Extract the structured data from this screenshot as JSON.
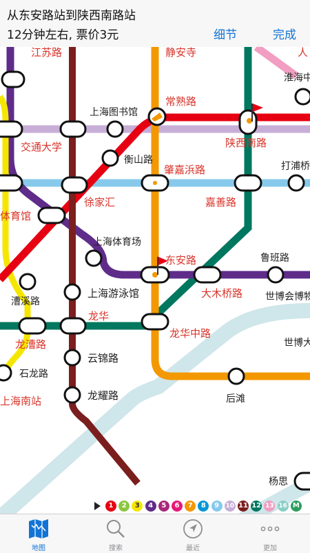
{
  "header": {
    "route_title": "从东安路站到陕西南路站",
    "route_summary": "12分钟左右, 票价3元",
    "detail_label": "细节",
    "done_label": "完成"
  },
  "stations": {
    "jiangsu_rd": "江苏路",
    "jingan_temple": "静安寺",
    "huaihai_rd": "淮海中",
    "top_right": "人",
    "shanghai_library": "上海图书馆",
    "changshu_rd": "常熟路",
    "jiaotong_univ": "交通大学",
    "shaanxi_south_rd": "陕西南路",
    "hengshan_rd": "衡山路",
    "zhaojiabang_rd": "肇嘉浜路",
    "dapuqiao": "打浦桥",
    "xujiahui": "徐家汇",
    "jiashan_rd": "嘉善路",
    "stadium": "体育馆",
    "shanghai_stadium": "上海体育场",
    "dongan_rd": "东安路",
    "luban_rd": "鲁班路",
    "caoxi_rd": "漕溪路",
    "shanghai_natatorium": "上海游泳馆",
    "damuqiao_rd": "大木桥路",
    "expo_museum": "世博会博物",
    "longhua": "龙华",
    "longhua_middle_rd": "龙华中路",
    "longcao_rd": "龙漕路",
    "yunjin_rd": "云锦路",
    "expo_avenue": "世博大",
    "shilong_rd": "石龙路",
    "houtan": "后滩",
    "longyao_rd": "龙耀路",
    "shanghai_south": "上海南站",
    "yangsi": "杨思"
  },
  "legend": {
    "lines": [
      {
        "label": "1",
        "color": "#e60012"
      },
      {
        "label": "2",
        "color": "#8cc63f"
      },
      {
        "label": "3",
        "color": "#f5e600"
      },
      {
        "label": "4",
        "color": "#5f2c8a"
      },
      {
        "label": "5",
        "color": "#a8287a"
      },
      {
        "label": "6",
        "color": "#e6197a"
      },
      {
        "label": "7",
        "color": "#f39800"
      },
      {
        "label": "8",
        "color": "#0097d6"
      },
      {
        "label": "9",
        "color": "#87c9eb"
      },
      {
        "label": "10",
        "color": "#c7aed7"
      },
      {
        "label": "11",
        "color": "#7b1e1e"
      },
      {
        "label": "12",
        "color": "#00775f"
      },
      {
        "label": "13",
        "color": "#f19ec2"
      },
      {
        "label": "16",
        "color": "#89cfc7"
      },
      {
        "label": "M",
        "color": "#2a9d5c"
      }
    ]
  },
  "tabs": [
    {
      "label": "地图",
      "icon": "map-icon"
    },
    {
      "label": "搜索",
      "icon": "search-icon"
    },
    {
      "label": "最近",
      "icon": "location-arrow-icon"
    },
    {
      "label": "更加",
      "icon": "more-icon"
    }
  ],
  "colors": {
    "accent": "#1273d6",
    "station_label_red": "#d9342b",
    "station_label_dark": "#222222",
    "line1": "#e60012",
    "line3": "#f5e600",
    "line4": "#5f2c8a",
    "line7": "#f39800",
    "line9": "#87c9eb",
    "line10": "#c7aed7",
    "line11": "#7b1e1e",
    "line12": "#00775f",
    "line13": "#f19ec2"
  }
}
